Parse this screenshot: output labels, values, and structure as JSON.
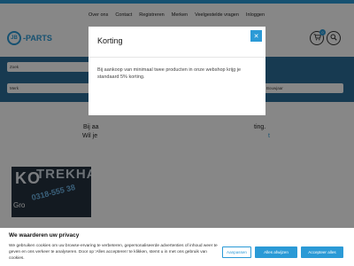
{
  "nav": {
    "items": [
      {
        "label": "Over ons"
      },
      {
        "label": "Contact"
      },
      {
        "label": "Registreren"
      },
      {
        "label": "Merken"
      },
      {
        "label": "Veelgestelde vragen"
      },
      {
        "label": "Inloggen"
      }
    ]
  },
  "logo": {
    "badge": "JB",
    "text": "-PARTS"
  },
  "header": {
    "cart_count": "0"
  },
  "filters": {
    "select_1": "Zoek",
    "select_2": "Merk",
    "select_3": "Bouwjaar"
  },
  "promo": {
    "line1_start": "Bij aa",
    "line1_end": "ting.",
    "line2_start": "Wil je",
    "line2_end": "t"
  },
  "tile": {
    "word": "KO",
    "overlay_word": "TREKHAKEN",
    "phone": "0318-555 38",
    "sub": "Gro"
  },
  "modal": {
    "title": "Korting",
    "close_icon": "close-icon",
    "body": "Bij aankoop van minimaal twee producten in onze webshop krijg je standaard 5% korting."
  },
  "cookie": {
    "title": "We waarderen uw privacy",
    "text": "We gebruiken cookies om uw browse-ervaring te verbeteren, gepersonaliseerde advertenties of inhoud weer te geven en ons verkeer te analyseren. Door op 'Alles accepteren' te klikken, stemt u in met ons gebruik van cookies.",
    "customize": "Aanpassen",
    "reject": "Alles afwijzen",
    "accept": "Accepteer alles"
  },
  "colors": {
    "accent": "#2b9ad6",
    "band": "#2d6e99",
    "overlay": "rgba(0,0,0,0.47)"
  }
}
